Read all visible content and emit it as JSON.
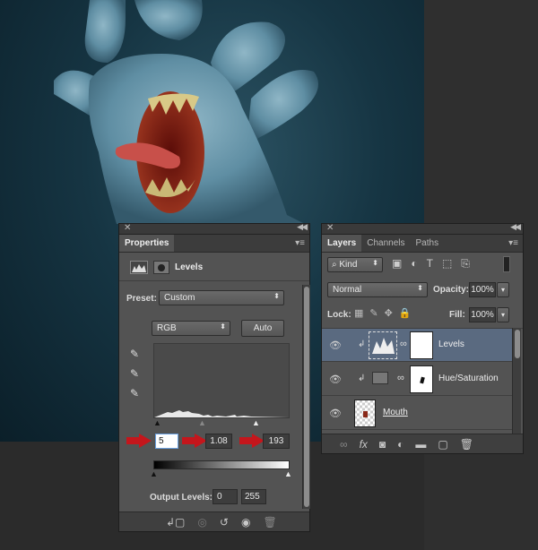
{
  "properties": {
    "tab": "Properties",
    "adjustment_name": "Levels",
    "preset_label": "Preset:",
    "preset_value": "Custom",
    "channel_value": "RGB",
    "auto_label": "Auto",
    "input_black": "5",
    "input_gamma": "1.08",
    "input_white": "193",
    "output_label": "Output Levels:",
    "output_black": "0",
    "output_white": "255"
  },
  "layers": {
    "tabs": [
      "Layers",
      "Channels",
      "Paths"
    ],
    "filter_label": "Kind",
    "blend_mode": "Normal",
    "opacity_label": "Opacity:",
    "opacity_value": "100%",
    "lock_label": "Lock:",
    "fill_label": "Fill:",
    "fill_value": "100%",
    "items": [
      {
        "name": "Levels",
        "selected": true
      },
      {
        "name": "Hue/Saturation",
        "selected": false
      },
      {
        "name": "Mouth",
        "selected": false
      }
    ]
  },
  "colors": {
    "panel_bg": "#535353",
    "selected_row": "#5a6a80",
    "annotation_arrow": "#c4161c"
  },
  "icons": [
    "close-icon",
    "collapse-icon",
    "panel-menu-icon",
    "histogram-icon",
    "mask-icon",
    "eyedropper-icon",
    "eye-icon",
    "link-icon",
    "trash-icon",
    "clip-icon",
    "lock-icon",
    "move-icon",
    "brush-icon"
  ]
}
